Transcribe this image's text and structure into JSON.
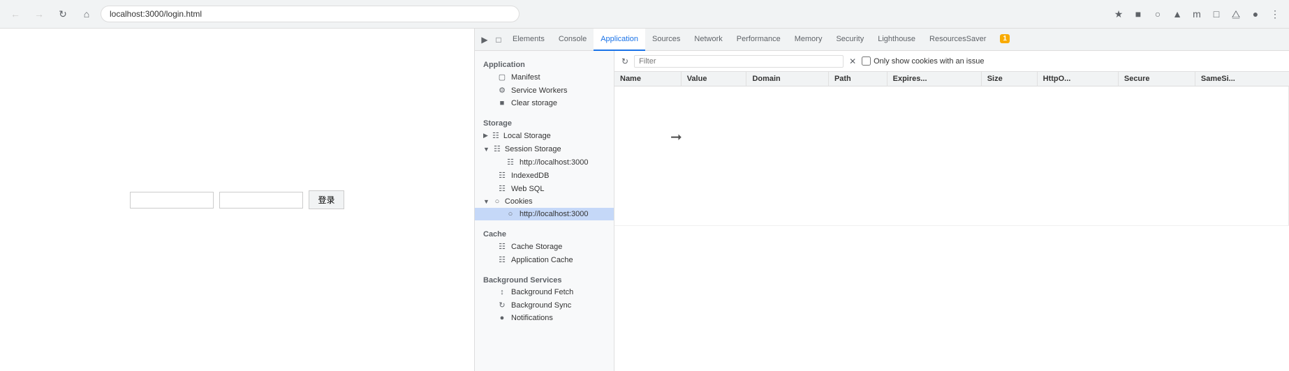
{
  "browser": {
    "back_btn": "←",
    "forward_btn": "→",
    "refresh_btn": "↻",
    "home_btn": "⌂",
    "url": "localhost:3000/login.html"
  },
  "login": {
    "btn_label": "登录"
  },
  "devtools": {
    "tabs": [
      {
        "label": "Elements",
        "active": false
      },
      {
        "label": "Console",
        "active": false
      },
      {
        "label": "Application",
        "active": true
      },
      {
        "label": "Sources",
        "active": false
      },
      {
        "label": "Network",
        "active": false
      },
      {
        "label": "Performance",
        "active": false
      },
      {
        "label": "Memory",
        "active": false
      },
      {
        "label": "Security",
        "active": false
      },
      {
        "label": "Lighthouse",
        "active": false
      },
      {
        "label": "ResourcesSaver",
        "active": false
      }
    ],
    "warning_count": "1"
  },
  "sidebar": {
    "application_label": "Application",
    "manifest_label": "Manifest",
    "service_workers_label": "Service Workers",
    "clear_storage_label": "Clear storage",
    "storage_label": "Storage",
    "local_storage_label": "Local Storage",
    "session_storage_label": "Session Storage",
    "session_storage_url": "http://localhost:3000",
    "indexeddb_label": "IndexedDB",
    "web_sql_label": "Web SQL",
    "cookies_label": "Cookies",
    "cookies_url": "http://localhost:3000",
    "cache_label": "Cache",
    "cache_storage_label": "Cache Storage",
    "application_cache_label": "Application Cache",
    "background_services_label": "Background Services",
    "background_fetch_label": "Background Fetch",
    "background_sync_label": "Background Sync",
    "notifications_label": "Notifications"
  },
  "filter_bar": {
    "placeholder": "Filter",
    "checkbox_label": "Only show cookies with an issue"
  },
  "table": {
    "columns": [
      "Name",
      "Value",
      "Domain",
      "Path",
      "Expires...",
      "Size",
      "HttpO...",
      "Secure",
      "SameSi..."
    ]
  }
}
